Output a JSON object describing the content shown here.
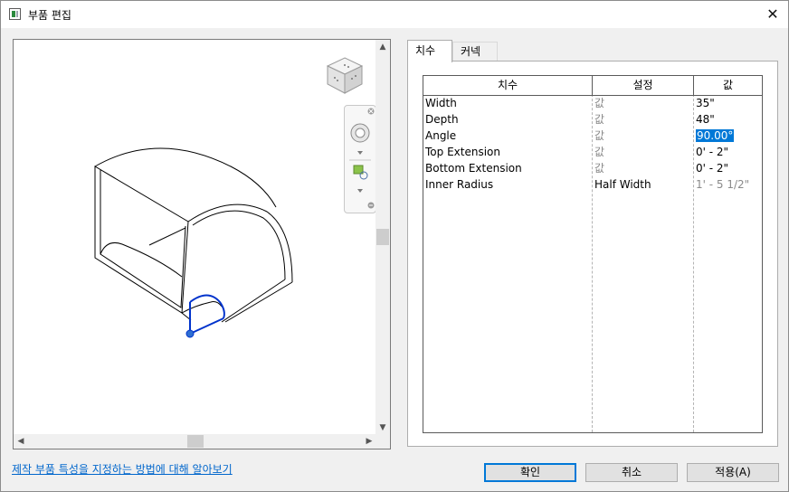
{
  "window": {
    "title": "부품 편집"
  },
  "tabs": [
    {
      "label": "치수"
    },
    {
      "label": "커넥터"
    }
  ],
  "table": {
    "headers": [
      "치수",
      "설정",
      "값"
    ],
    "rows": [
      {
        "name": "Width",
        "setting": "값",
        "value": "35\"",
        "value_style": "normal"
      },
      {
        "name": "Depth",
        "setting": "값",
        "value": "48\"",
        "value_style": "normal"
      },
      {
        "name": "Angle",
        "setting": "값",
        "value": "90.00°",
        "value_style": "selected"
      },
      {
        "name": "Top Extension",
        "setting": "값",
        "value": "0' - 2\"",
        "value_style": "normal"
      },
      {
        "name": "Bottom Extension",
        "setting": "값",
        "value": "0' - 2\"",
        "value_style": "normal"
      },
      {
        "name": "Inner Radius",
        "setting": "Half Width",
        "value": "1' - 5 1/2\"",
        "value_style": "grey"
      }
    ]
  },
  "help_link": "제작 부품 특성을 지정하는 방법에 대해 알아보기",
  "buttons": {
    "ok": "확인",
    "cancel": "취소",
    "apply": "적용(A)"
  },
  "icons": {
    "close": "close-icon",
    "app": "family-editor-icon",
    "viewcube": "viewcube-icon",
    "steering_wheel": "steering-wheel-icon",
    "zoom": "zoom-region-icon"
  },
  "colors": {
    "accent": "#0078d7",
    "link": "#0066cc",
    "selected_line": "#0033cc"
  }
}
